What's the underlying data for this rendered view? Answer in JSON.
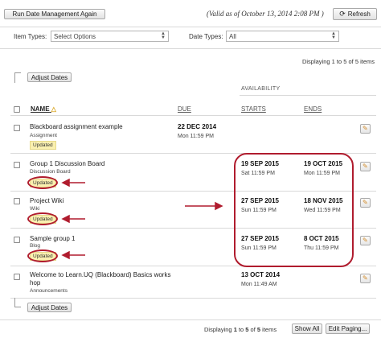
{
  "toolbar": {
    "run_button": "Run Date Management Again",
    "valid_as_of": "(Valid as of October 13, 2014 2:08 PM )",
    "refresh_label": "Refresh"
  },
  "filters": {
    "item_types_label": "Item Types:",
    "item_types_value": "Select Options",
    "date_types_label": "Date Types:",
    "date_types_value": "All"
  },
  "paging": {
    "top_text": "Displaying 1 to 5 of 5 items",
    "bottom_prefix": "Displaying ",
    "bottom_start": "1",
    "bottom_mid1": " to ",
    "bottom_end": "5",
    "bottom_mid2": " of ",
    "bottom_total": "5",
    "bottom_suffix": " items",
    "show_all": "Show All",
    "edit_paging": "Edit Paging..."
  },
  "actions": {
    "adjust_dates": "Adjust Dates"
  },
  "table": {
    "availability_header": "AVAILABILITY",
    "columns": {
      "name": "NAME",
      "due": "DUE",
      "starts": "STARTS",
      "ends": "ENDS"
    },
    "rows": [
      {
        "title": "Blackboard assignment example",
        "type": "Assignment",
        "badge": "Updated",
        "due_date": "22 DEC 2014",
        "due_time": "Mon 11:59 PM",
        "start_date": "",
        "start_time": "",
        "end_date": "",
        "end_time": ""
      },
      {
        "title": "Group 1 Discussion Board",
        "type": "Discussion Board",
        "badge": "Updated",
        "due_date": "",
        "due_time": "",
        "start_date": "19 SEP 2015",
        "start_time": "Sat 11:59 PM",
        "end_date": "19 OCT 2015",
        "end_time": "Mon 11:59 PM"
      },
      {
        "title": "Project Wiki",
        "type": "Wiki",
        "badge": "Updated",
        "due_date": "",
        "due_time": "",
        "start_date": "27 SEP 2015",
        "start_time": "Sun 11:59 PM",
        "end_date": "18 NOV 2015",
        "end_time": "Wed 11:59 PM"
      },
      {
        "title": "Sample group 1",
        "type": "Blog",
        "badge": "Updated",
        "due_date": "",
        "due_time": "",
        "start_date": "27 SEP 2015",
        "start_time": "Sun 11:59 PM",
        "end_date": "8 OCT 2015",
        "end_time": "Thu 11:59 PM"
      },
      {
        "title_line1": "Welcome to Learn.UQ (Blackboard) Basics works",
        "title_line2": "hop",
        "type": "Announcements",
        "badge": "",
        "due_date": "",
        "due_time": "",
        "start_date": "13 OCT 2014",
        "start_time": "Mon 11:49 AM",
        "end_date": "",
        "end_time": ""
      }
    ]
  },
  "colors": {
    "annotation": "#b01c2e",
    "badge_bg": "#faf0b0"
  }
}
